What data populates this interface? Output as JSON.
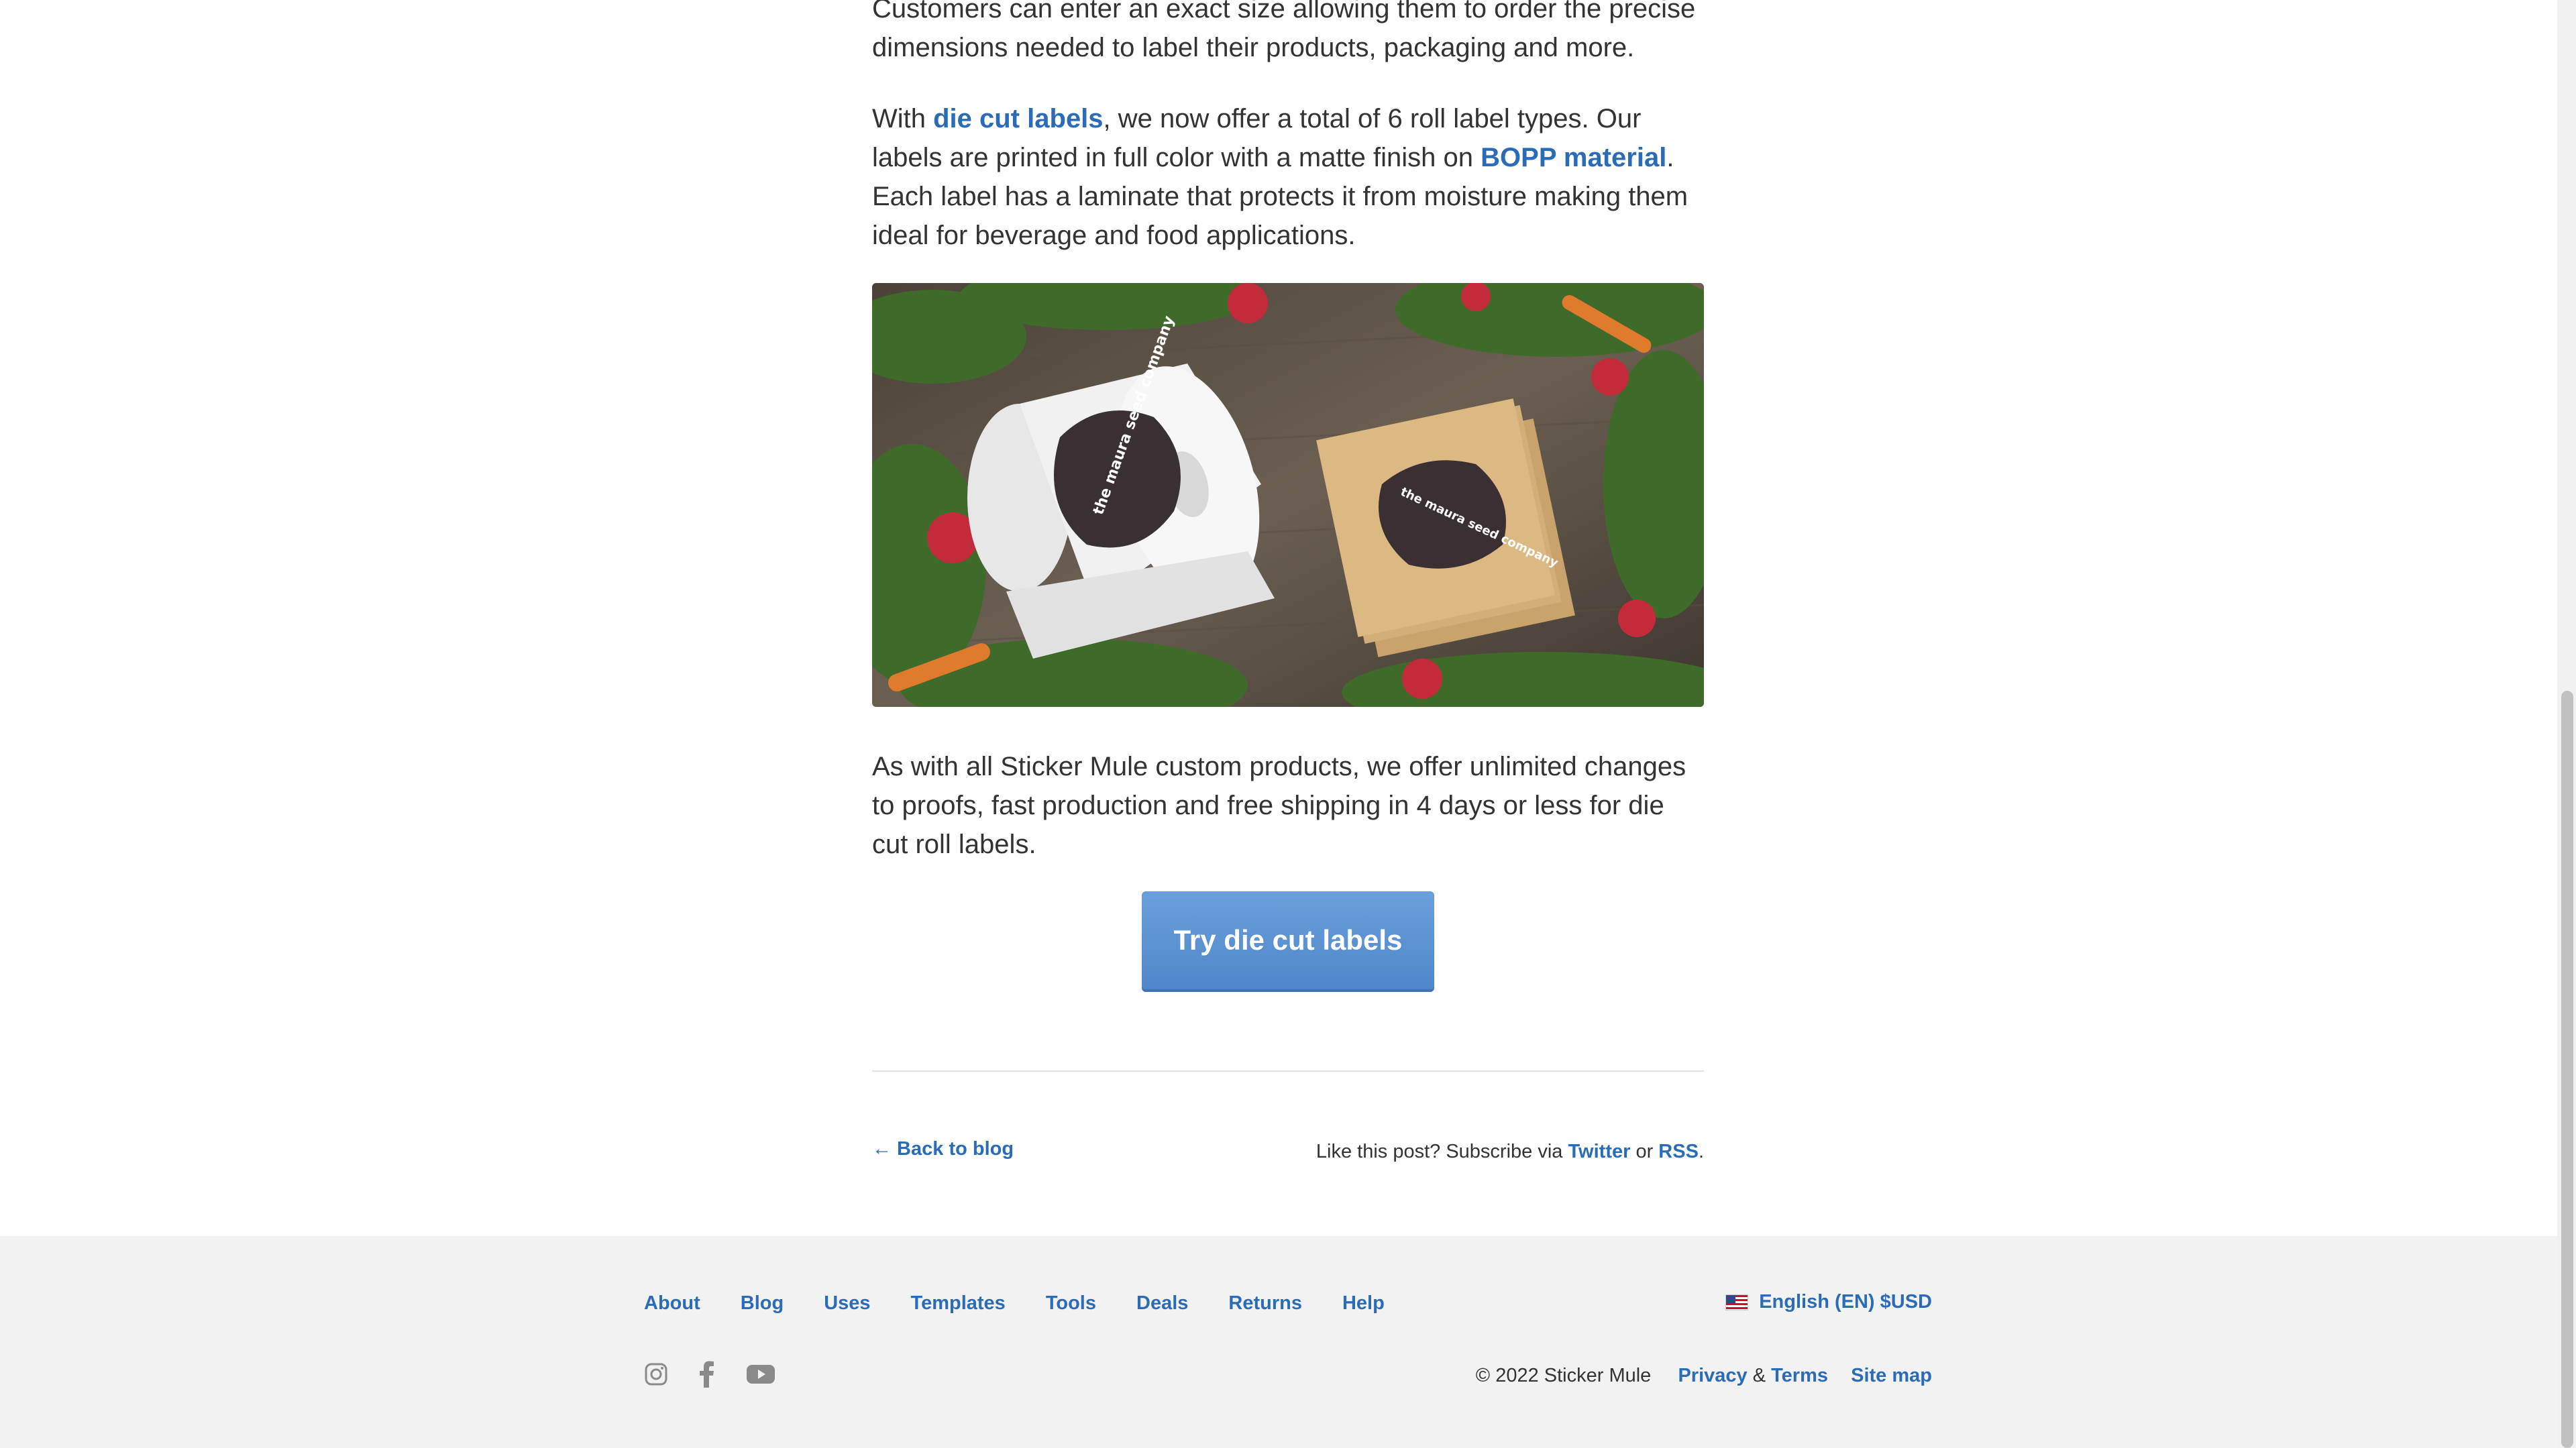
{
  "article": {
    "p1": "Customers can enter an exact size allowing them to order the precise dimensions needed to label their products, packaging and more.",
    "p2": {
      "t1": "With ",
      "link1": "die cut labels",
      "t2": ", we now offer a total of 6 roll label types. Our labels are printed in full color with a matte finish on ",
      "link2": "BOPP material",
      "t3": ". Each label has a laminate that protects it from moisture making them ideal for beverage and food applications."
    },
    "photo_labels": {
      "roll_brand": "the maura seed company",
      "card_brand": "the maura seed company"
    },
    "p3": "As with all Sticker Mule custom products, we offer unlimited changes to proofs, fast production and free shipping in 4 days or less for die cut roll labels.",
    "cta": "Try die cut labels"
  },
  "post_footer": {
    "back": "← Back to blog",
    "subscribe_text": "Like this post? Subscribe via ",
    "twitter": "Twitter",
    "or": " or ",
    "rss": "RSS",
    "period": "."
  },
  "footer": {
    "nav": [
      "About",
      "Blog",
      "Uses",
      "Templates",
      "Tools",
      "Deals",
      "Returns",
      "Help"
    ],
    "language": "English (EN) $USD",
    "copyright": "© 2022 Sticker Mule",
    "privacy": "Privacy",
    "amp": " & ",
    "terms": "Terms",
    "sitemap": "Site map",
    "social_icons": [
      "instagram-icon",
      "facebook-icon",
      "youtube-icon"
    ]
  },
  "colors": {
    "link": "#2b6cb8",
    "cta": "#5b91d1",
    "footer_bg": "#f2f2f2"
  }
}
